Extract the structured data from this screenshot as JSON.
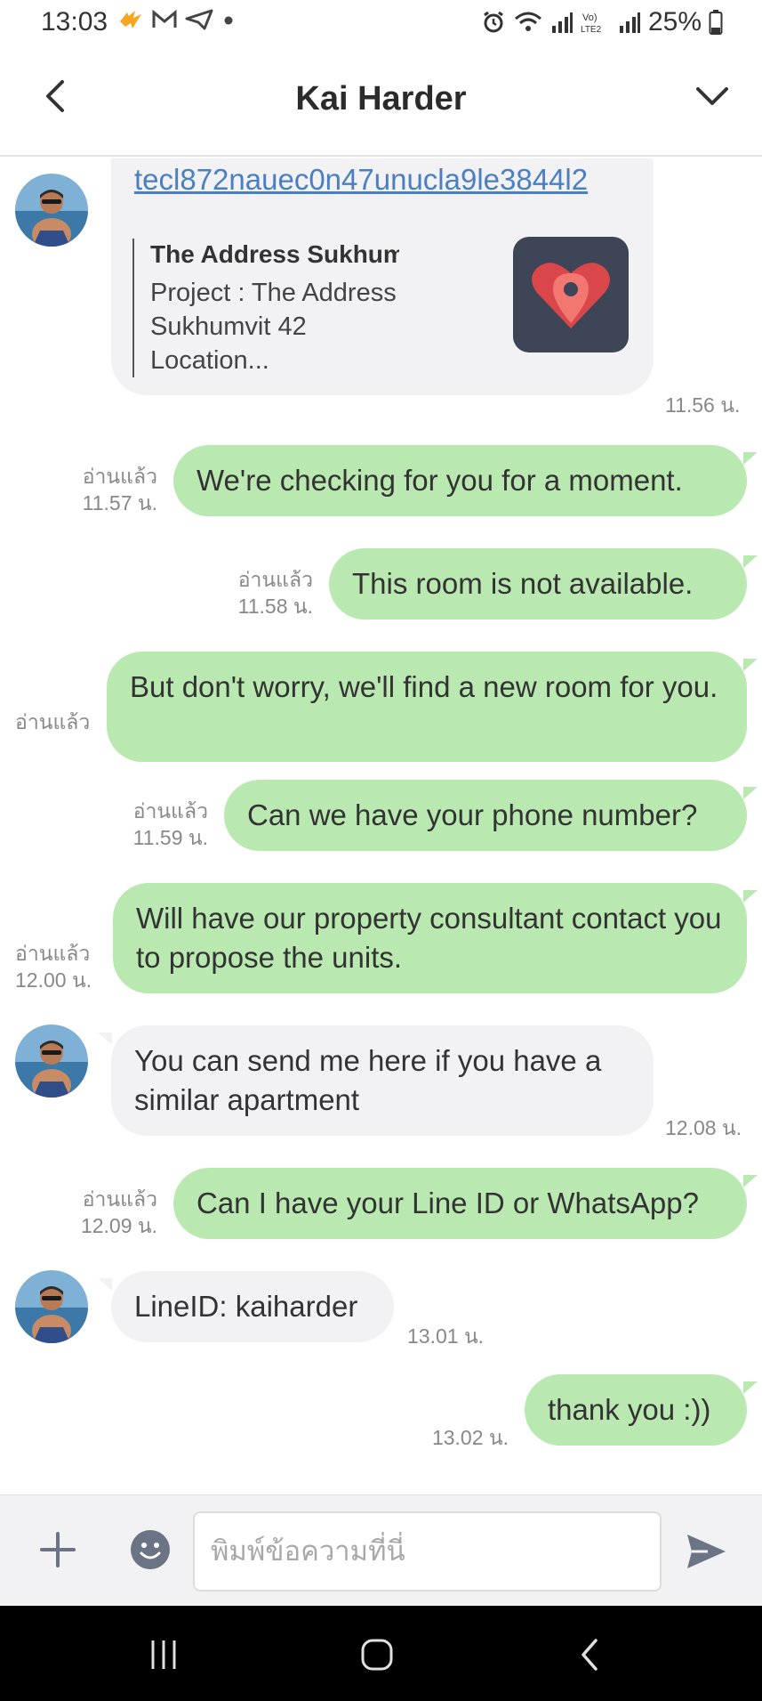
{
  "status_bar": {
    "time": "13:03",
    "battery": "25%",
    "left_icons": [
      "fire-app-icon",
      "gmail-icon",
      "telegram-icon",
      "dot-icon"
    ],
    "right_icons": [
      "alarm-icon",
      "wifi-icon",
      "signal-icon",
      "volte-icon",
      "signal-icon",
      "battery-icon"
    ]
  },
  "header": {
    "title": "Kai Harder"
  },
  "messages": [
    {
      "id": "m1",
      "direction": "in",
      "link_text": "tecl872nauec0n47unucla9le3844l2",
      "preview_title": "The Address Sukhumvit ...",
      "preview_desc": "Project : The Address Sukhumvit 42 Location...",
      "time": "11.56 น."
    },
    {
      "id": "m2",
      "direction": "out",
      "text": "We're checking for you for a moment.",
      "read": "อ่านแล้ว",
      "time": "11.57 น."
    },
    {
      "id": "m3",
      "direction": "out",
      "text": "This room is not available.",
      "read": "อ่านแล้ว",
      "time": "11.58 น."
    },
    {
      "id": "m4",
      "direction": "out",
      "text": "But don't worry, we'll find a new room for you.",
      "read": "อ่านแล้ว",
      "time": ""
    },
    {
      "id": "m5",
      "direction": "out",
      "text": "Can we have your phone number?",
      "read": "อ่านแล้ว",
      "time": "11.59 น."
    },
    {
      "id": "m6",
      "direction": "out",
      "text": "Will have our property consultant contact you to propose the units.",
      "read": "อ่านแล้ว",
      "time": "12.00 น."
    },
    {
      "id": "m7",
      "direction": "in",
      "text": "You can send me here if you have a similar apartment",
      "time": "12.08 น."
    },
    {
      "id": "m8",
      "direction": "out",
      "text": "Can I have your Line ID or WhatsApp?",
      "read": "อ่านแล้ว",
      "time": "12.09 น."
    },
    {
      "id": "m9",
      "direction": "in",
      "text": "LineID: kaiharder",
      "time": "13.01 น."
    },
    {
      "id": "m10",
      "direction": "out",
      "text": "thank you :))",
      "read": "",
      "time": "13.02 น."
    }
  ],
  "input": {
    "placeholder": "พิมพ์ข้อความที่นี่"
  },
  "colors": {
    "outgoing_bubble": "#b9e8b0",
    "incoming_bubble": "#f2f2f4",
    "link": "#4a7fc1",
    "icon_gray": "#6b7485"
  }
}
